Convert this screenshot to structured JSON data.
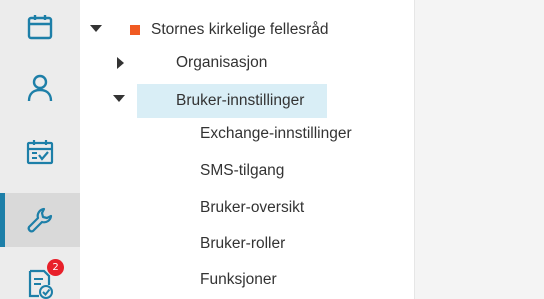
{
  "sidebar": {
    "items": [
      {
        "icon": "calendar-icon",
        "active": false
      },
      {
        "icon": "user-icon",
        "active": false
      },
      {
        "icon": "calendar-check-icon",
        "active": false
      },
      {
        "icon": "wrench-icon",
        "active": true
      },
      {
        "icon": "document-check-icon",
        "active": false,
        "badge": "2"
      }
    ],
    "accent_color": "#1d7fa8",
    "badge_color": "#e8202a"
  },
  "tree": {
    "root": {
      "label": "Stornes kirkelige fellesråd",
      "color": "#f05a22"
    },
    "organisasjon": {
      "label": "Organisasjon"
    },
    "bruker_innstillinger": {
      "label": "Bruker-innstillinger",
      "selected": true
    },
    "children": [
      {
        "label": "Exchange-innstillinger"
      },
      {
        "label": "SMS-tilgang"
      },
      {
        "label": "Bruker-oversikt"
      },
      {
        "label": "Bruker-roller"
      },
      {
        "label": "Funksjoner"
      }
    ]
  }
}
